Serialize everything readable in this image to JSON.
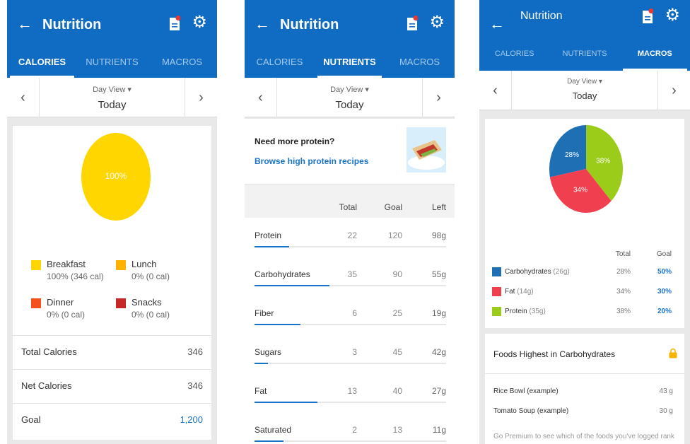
{
  "screens": [
    {
      "header": {
        "title": "Nutrition"
      },
      "tabs": [
        "CALORIES",
        "NUTRIENTS",
        "MACROS"
      ],
      "active_tab": 0,
      "dayview": {
        "label": "Day View",
        "value": "Today"
      },
      "pie": {
        "label": "100%",
        "color": "#ffd600"
      },
      "legend": [
        {
          "name": "Breakfast",
          "value": "100% (346 cal)",
          "color": "#ffd600"
        },
        {
          "name": "Lunch",
          "value": "0% (0 cal)",
          "color": "#ffb300"
        },
        {
          "name": "Dinner",
          "value": "0% (0 cal)",
          "color": "#f4511e"
        },
        {
          "name": "Snacks",
          "value": "0% (0 cal)",
          "color": "#c62828"
        }
      ],
      "rows": [
        {
          "label": "Total Calories",
          "value": "346"
        },
        {
          "label": "Net Calories",
          "value": "346"
        },
        {
          "label": "Goal",
          "value": "1,200"
        }
      ]
    },
    {
      "header": {
        "title": "Nutrition"
      },
      "tabs": [
        "CALORIES",
        "NUTRIENTS",
        "MACROS"
      ],
      "active_tab": 1,
      "dayview": {
        "label": "Day View",
        "value": "Today"
      },
      "promo": {
        "question": "Need more protein?",
        "link": "Browse high protein recipes"
      },
      "columns": [
        "Total",
        "Goal",
        "Left"
      ],
      "nutrients": [
        {
          "name": "Protein",
          "total": "22",
          "goal": "120",
          "left": "98g",
          "progress": 0.18
        },
        {
          "name": "Carbohydrates",
          "total": "35",
          "goal": "90",
          "left": "55g",
          "progress": 0.39
        },
        {
          "name": "Fiber",
          "total": "6",
          "goal": "25",
          "left": "19g",
          "progress": 0.24
        },
        {
          "name": "Sugars",
          "total": "3",
          "goal": "45",
          "left": "42g",
          "progress": 0.07
        },
        {
          "name": "Fat",
          "total": "13",
          "goal": "40",
          "left": "27g",
          "progress": 0.33
        },
        {
          "name": "Saturated",
          "total": "2",
          "goal": "13",
          "left": "11g",
          "progress": 0.15
        }
      ]
    },
    {
      "header": {
        "title": "Nutrition"
      },
      "tabs": [
        "CALORIES",
        "NUTRIENTS",
        "MACROS"
      ],
      "active_tab": 2,
      "dayview": {
        "label": "Day View",
        "value": "Today"
      },
      "columns": [
        "Total",
        "Goal"
      ],
      "macros": [
        {
          "name": "Carbohydrates",
          "amount": "(26g)",
          "total": "28%",
          "goal": "50%",
          "share": 28,
          "color": "#1f6fb5"
        },
        {
          "name": "Fat",
          "amount": "(14g)",
          "total": "34%",
          "goal": "30%",
          "share": 34,
          "color": "#f0404f"
        },
        {
          "name": "Protein",
          "amount": "(35g)",
          "total": "38%",
          "goal": "20%",
          "share": 38,
          "color": "#9ccc1a"
        }
      ],
      "foods": {
        "heading": "Foods Highest in Carbohydrates",
        "items": [
          {
            "name": "Rice Bowl (example)",
            "value": "43 g"
          },
          {
            "name": "Tomato Soup (example)",
            "value": "30 g"
          }
        ],
        "note": "Go Premium to see which of the foods you've logged rank"
      }
    }
  ],
  "icons": {
    "back": "arrow-left-icon",
    "doc": "document-icon",
    "gear": "gear-icon",
    "lock": "lock-icon"
  }
}
